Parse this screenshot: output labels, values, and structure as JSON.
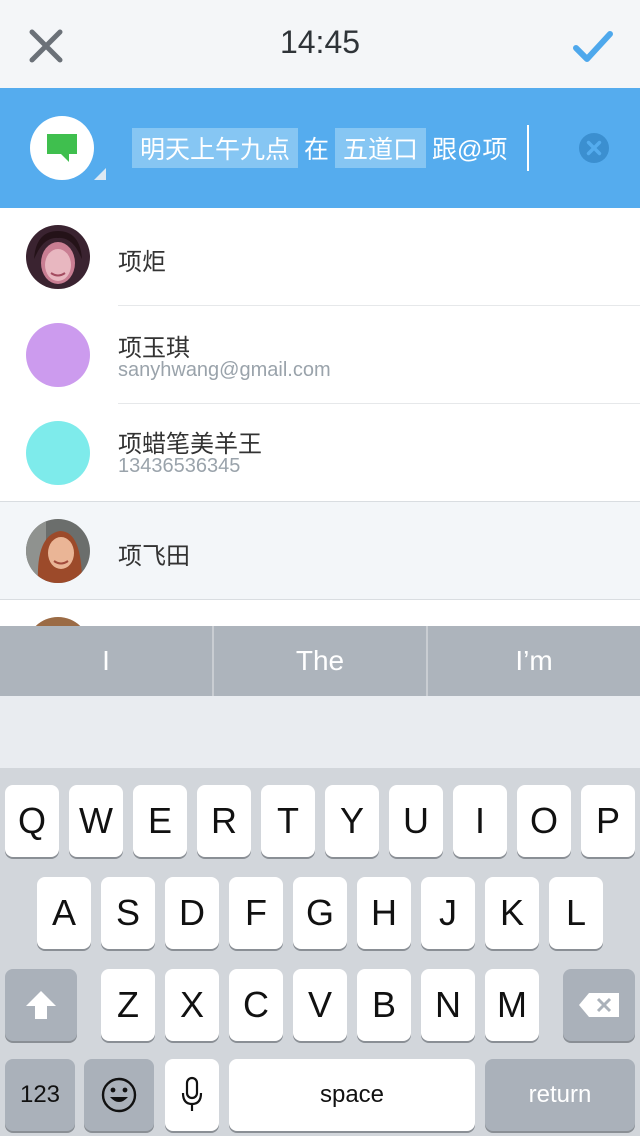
{
  "status": {
    "time": "14:45"
  },
  "nav": {
    "close_icon": "close-icon",
    "confirm_icon": "check-icon",
    "confirm_color": "#4ea8ec"
  },
  "input": {
    "tokens": [
      {
        "text": "明天上午九点",
        "highlighted": true
      },
      {
        "text": "在",
        "highlighted": false
      },
      {
        "text": "五道口",
        "highlighted": true
      },
      {
        "text": "跟@项",
        "highlighted": false
      }
    ],
    "type_icon": "message-icon",
    "clear_icon": "clear-circle-icon",
    "accent": "#55acee"
  },
  "contacts": [
    {
      "name": "项炬",
      "detail": "",
      "avatar": "photo",
      "color": ""
    },
    {
      "name": "项玉琪",
      "detail": "sanyhwang@gmail.com",
      "avatar": "color",
      "color": "#cc9bee"
    },
    {
      "name": "项蜡笔美羊王",
      "detail": "13436536345",
      "avatar": "color",
      "color": "#7eebeb"
    },
    {
      "name": "项飞田",
      "detail": "",
      "avatar": "photo",
      "color": ""
    }
  ],
  "suggestions": [
    "I",
    "The",
    "I’m"
  ],
  "keyboard": {
    "row1": [
      "Q",
      "W",
      "E",
      "R",
      "T",
      "Y",
      "U",
      "I",
      "O",
      "P"
    ],
    "row2": [
      "A",
      "S",
      "D",
      "F",
      "G",
      "H",
      "J",
      "K",
      "L"
    ],
    "row3": [
      "Z",
      "X",
      "C",
      "V",
      "B",
      "N",
      "M"
    ],
    "shift_icon": "shift-icon",
    "backspace_icon": "backspace-icon",
    "numbers_label": "123",
    "emoji_icon": "emoji-icon",
    "mic_icon": "microphone-icon",
    "space_label": "space",
    "return_label": "return"
  }
}
